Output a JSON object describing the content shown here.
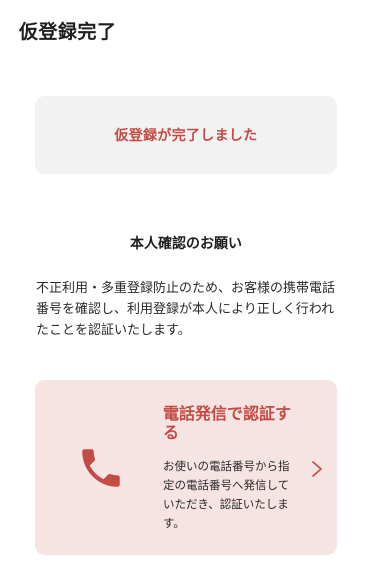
{
  "header": {
    "title": "仮登録完了"
  },
  "status": {
    "message": "仮登録が完了しました"
  },
  "identity": {
    "heading": "本人確認のお願い",
    "description": "不正利用・多重登録防止のため、お客様の携帯電話番号を確認し、利用登録が本人により正しく行われたことを認証いたします。"
  },
  "call_option": {
    "title": "電話発信で認証する",
    "description": "お使いの電話番号から指定の電話番号へ発信していただき、認証いたします。",
    "icon": "phone-icon",
    "arrow_icon": "chevron-right-icon"
  },
  "colors": {
    "accent": "#c34b43",
    "status_bg": "#f2f2f2",
    "card_bg": "#f5e4e2"
  }
}
